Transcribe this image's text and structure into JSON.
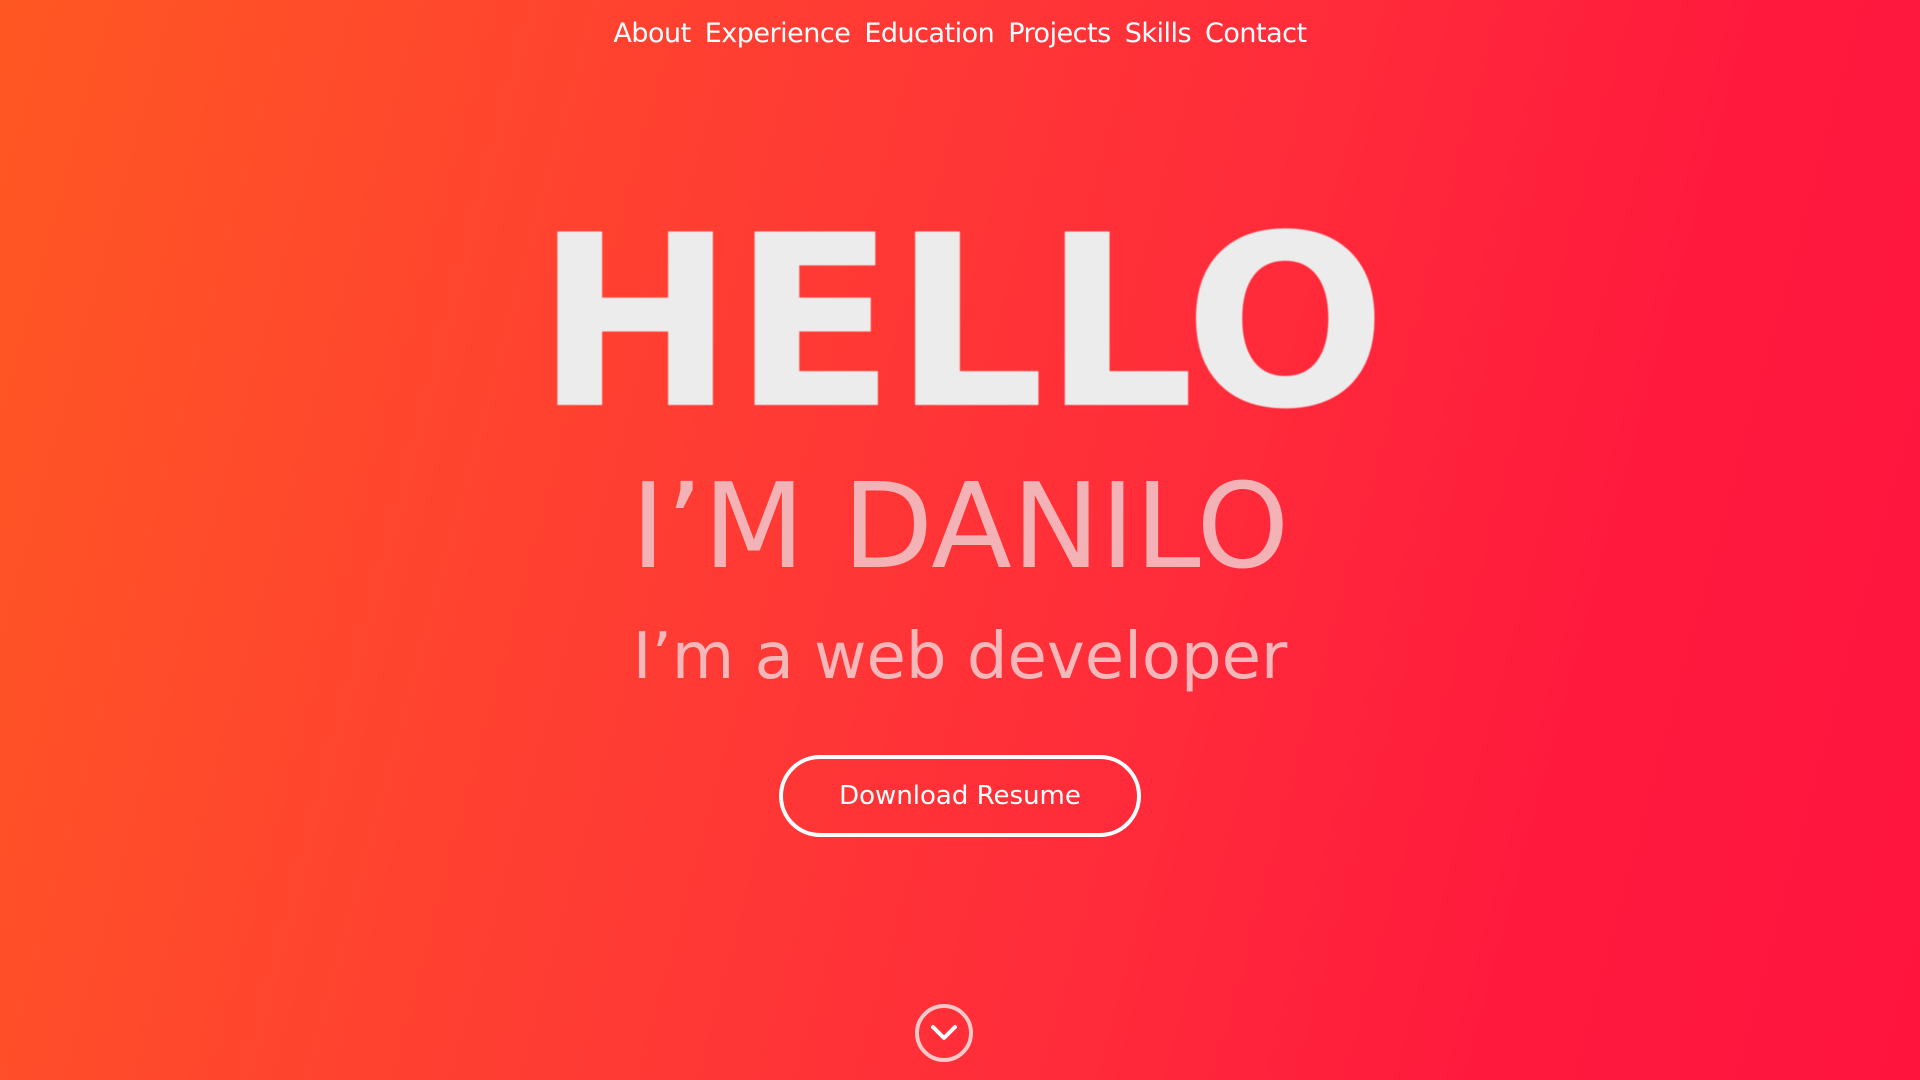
{
  "nav": {
    "items": [
      {
        "label": "About"
      },
      {
        "label": "Experience"
      },
      {
        "label": "Education"
      },
      {
        "label": "Projects"
      },
      {
        "label": "Skills"
      },
      {
        "label": "Contact"
      }
    ]
  },
  "hero": {
    "greeting": "HELLO",
    "name": "I’M DANILO",
    "tagline": "I’m a web developer"
  },
  "cta": {
    "label": "Download Resume"
  },
  "icons": {
    "scroll_down": "chevron-down-icon"
  },
  "colors": {
    "gradient_start": "#ff5722",
    "gradient_end": "#ff143e",
    "greeting_text": "#ececec",
    "name_text": "#f3b2b5",
    "button_border": "#ffffff"
  }
}
